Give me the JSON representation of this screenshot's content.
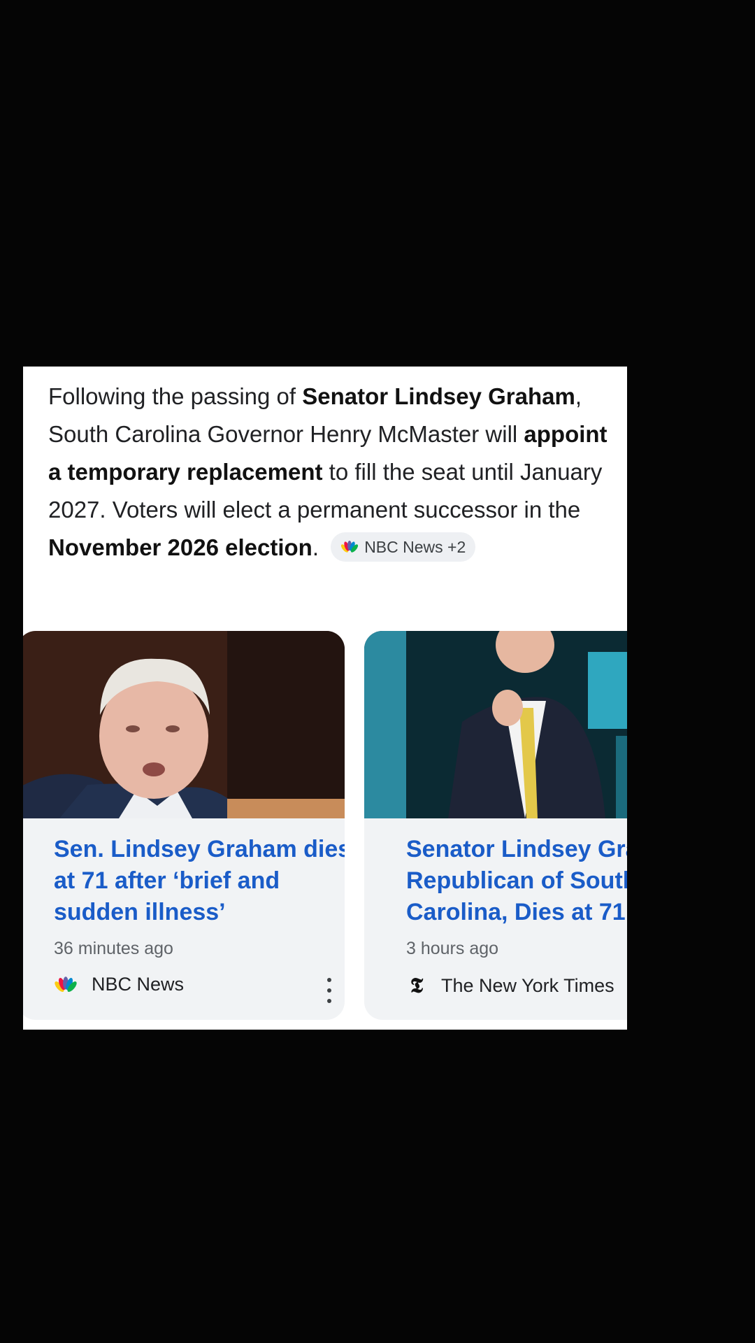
{
  "summary": {
    "parts": [
      {
        "text": "Following the passing of ",
        "bold": false
      },
      {
        "text": "Senator Lindsey Graham",
        "bold": true
      },
      {
        "text": ", South Carolina Governor Henry McMaster will ",
        "bold": false
      },
      {
        "text": "appoint a temporary replacement",
        "bold": true
      },
      {
        "text": " to fill the seat until January 2027. Voters will elect a permanent successor in the ",
        "bold": false
      },
      {
        "text": "November 2026 election",
        "bold": true
      },
      {
        "text": ".",
        "bold": false
      }
    ],
    "source_chip": "NBC News +2"
  },
  "cards": [
    {
      "headline_lines": [
        "Sen. Lindsey Graham dies",
        "at 71 after ‘brief and",
        "sudden illness’"
      ],
      "time": "36 minutes ago",
      "source": "NBC News",
      "source_icon": "nbc-peacock-icon"
    },
    {
      "headline_lines": [
        "Senator Lindsey Graham,",
        "Republican of South",
        "Carolina, Dies at 71"
      ],
      "time": "3 hours ago",
      "source": "The New York Times",
      "source_icon": "nyt-logo-icon"
    }
  ],
  "colors": {
    "background": "#050505",
    "headline": "#1a5cc8",
    "card_bg": "#f1f3f5",
    "chip_bg": "#eef0f3"
  }
}
